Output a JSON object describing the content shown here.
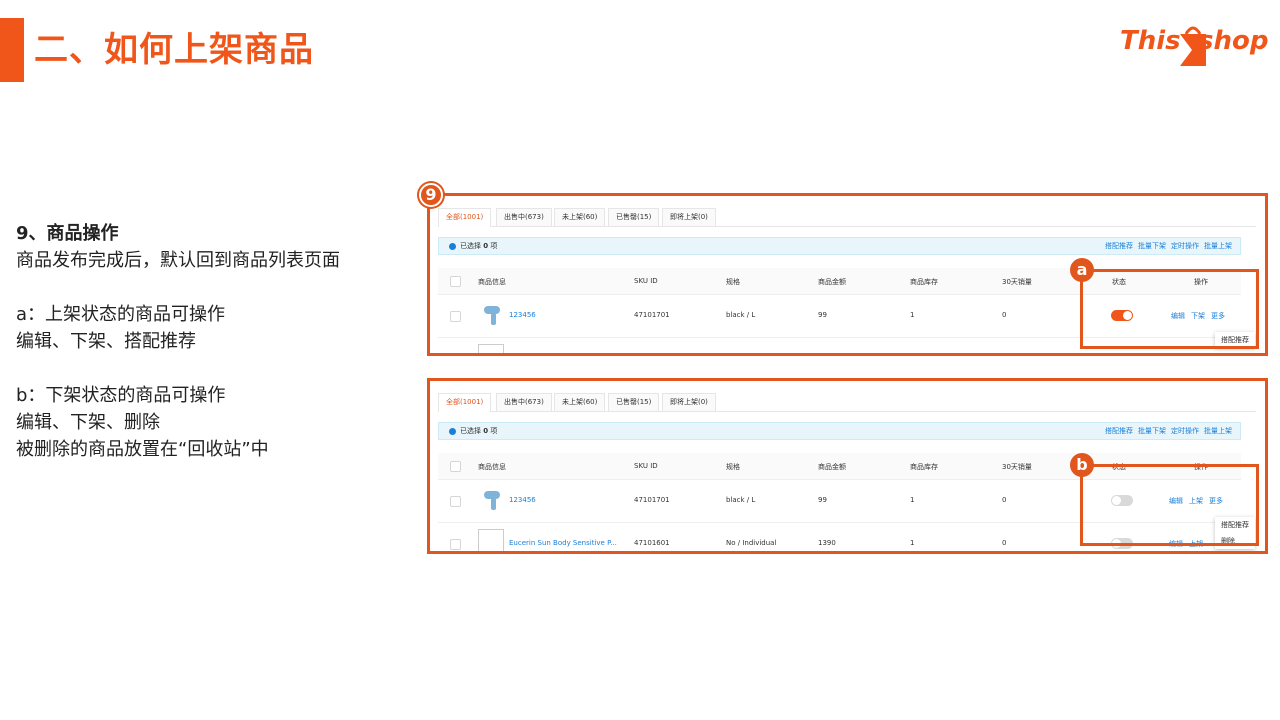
{
  "page": {
    "title": "二、如何上架商品",
    "logo": {
      "part1": "This",
      "part2": "shop",
      "color": "#f0561a"
    }
  },
  "description": {
    "heading": "9、商品操作",
    "intro": "商品发布完成后，默认回到商品列表页面",
    "a_title": "a：上架状态的商品可操作",
    "a_ops": "编辑、下架、搭配推荐",
    "b_title": "b：下架状态的商品可操作",
    "b_ops": "编辑、下架、删除",
    "b_note": "被删除的商品放置在“回收站”中"
  },
  "badges": {
    "step": "9",
    "a": "a",
    "b": "b"
  },
  "panel": {
    "tabs": [
      "全部(1001)",
      "出售中(673)",
      "未上架(60)",
      "已售罄(15)",
      "即将上架(0)"
    ],
    "selected_prefix": "已选择",
    "selected_count": "0",
    "selected_suffix": "项",
    "bulk_actions": [
      "搭配推荐",
      "批量下架",
      "定时操作",
      "批量上架"
    ],
    "columns": [
      "商品信息",
      "SKU ID",
      "规格",
      "商品金额",
      "商品库存",
      "30天销量",
      "状态",
      "操作"
    ]
  },
  "screen1": {
    "row": {
      "name": "123456",
      "sku": "47101701",
      "spec": "black / L",
      "price": "99",
      "stock": "1",
      "sales": "0",
      "status": "on",
      "ops": [
        "编辑",
        "下架",
        "更多"
      ]
    },
    "dropdown": [
      "搭配推荐"
    ]
  },
  "screen2": {
    "rows": [
      {
        "name": "123456",
        "sku": "47101701",
        "spec": "black / L",
        "price": "99",
        "stock": "1",
        "sales": "0",
        "status": "off",
        "ops": [
          "编辑",
          "上架",
          "更多"
        ]
      },
      {
        "name": "Eucerin Sun Body Sensitive P...",
        "sku": "47101601",
        "spec": "No / Individual",
        "price": "1390",
        "stock": "1",
        "sales": "0",
        "status": "off",
        "ops": [
          "编辑",
          "上架"
        ]
      }
    ],
    "dropdown": [
      "搭配推荐",
      "删除"
    ]
  }
}
